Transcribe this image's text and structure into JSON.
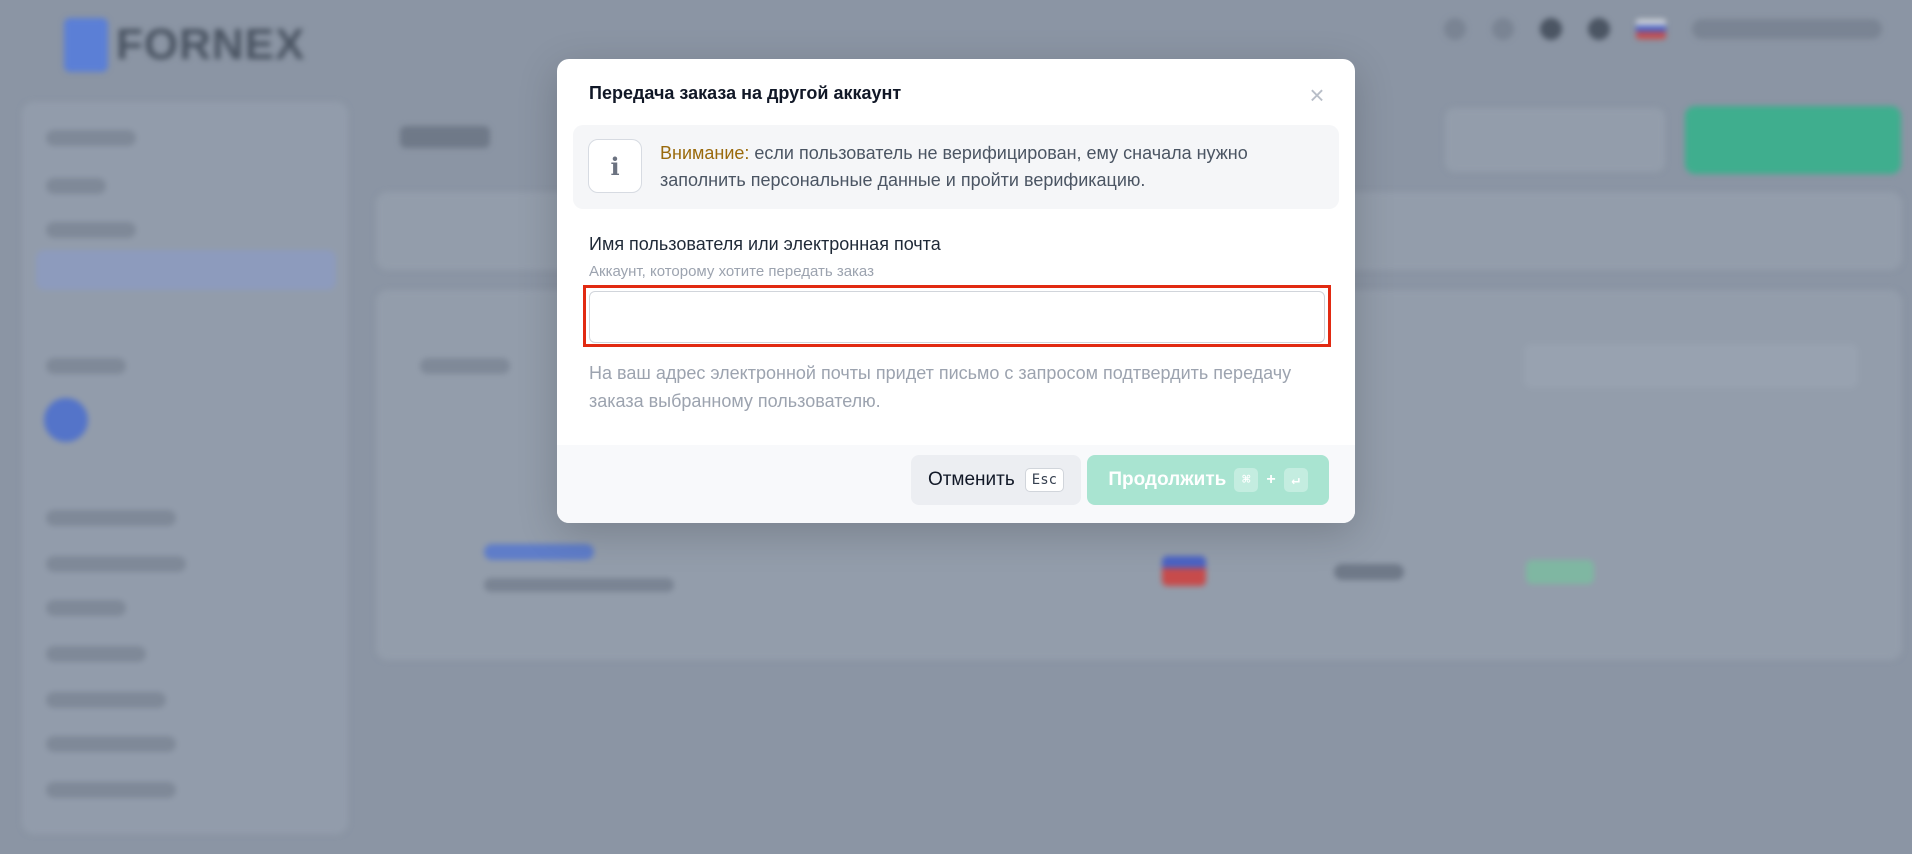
{
  "modal": {
    "title": "Передача заказа на другой аккаунт",
    "close_icon": "×",
    "alert": {
      "icon": "i",
      "warning_label": "Внимание:",
      "text": " если пользователь не верифицирован, ему сначала нужно заполнить персональные данные и пройти верификацию."
    },
    "field": {
      "label": "Имя пользователя или электронная почта",
      "hint": "Аккаунт, которому хотите передать заказ",
      "value": "",
      "placeholder": ""
    },
    "note": "На ваш адрес электронной почты придет письмо с запросом подтвердить передачу заказа выбранному пользователю.",
    "buttons": {
      "cancel_label": "Отменить",
      "cancel_key": "Esc",
      "continue_label": "Продолжить",
      "continue_key_cmd": "⌘",
      "continue_key_plus": "+",
      "continue_key_enter": "↵"
    }
  },
  "colors": {
    "highlight_outline": "#e12a12",
    "warning": "#9a6a0c",
    "primary_disabled": "#a9e4d1"
  }
}
